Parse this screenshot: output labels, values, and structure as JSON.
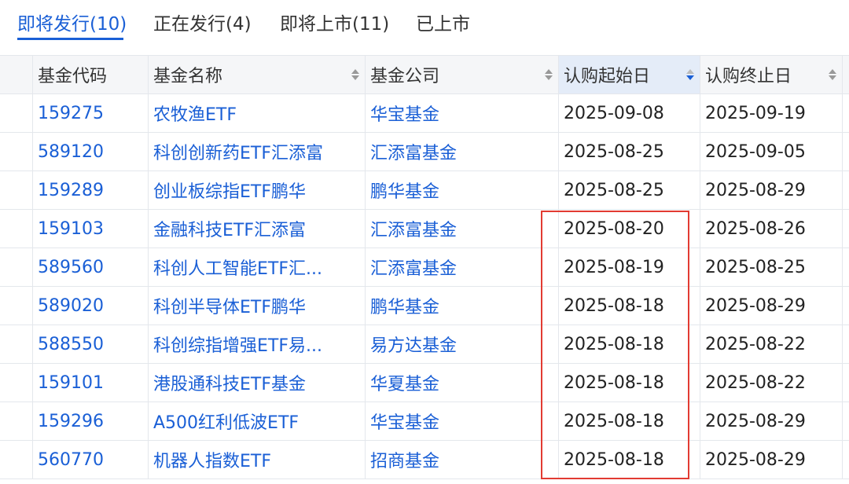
{
  "tabs": [
    {
      "label": "即将发行(10)",
      "active": true
    },
    {
      "label": "正在发行(4)",
      "active": false
    },
    {
      "label": "即将上市(11)",
      "active": false
    },
    {
      "label": "已上市",
      "active": false
    }
  ],
  "table": {
    "headers": {
      "code": "基金代码",
      "name": "基金名称",
      "company": "基金公司",
      "start": "认购起始日",
      "end": "认购终止日"
    },
    "rows": [
      {
        "code": "159275",
        "name": "农牧渔ETF",
        "company": "华宝基金",
        "start": "2025-09-08",
        "end": "2025-09-19"
      },
      {
        "code": "589120",
        "name": "科创创新药ETF汇添富",
        "company": "汇添富基金",
        "start": "2025-08-25",
        "end": "2025-09-05"
      },
      {
        "code": "159289",
        "name": "创业板综指ETF鹏华",
        "company": "鹏华基金",
        "start": "2025-08-25",
        "end": "2025-08-29"
      },
      {
        "code": "159103",
        "name": "金融科技ETF汇添富",
        "company": "汇添富基金",
        "start": "2025-08-20",
        "end": "2025-08-26"
      },
      {
        "code": "589560",
        "name": "科创人工智能ETF汇...",
        "company": "汇添富基金",
        "start": "2025-08-19",
        "end": "2025-08-25"
      },
      {
        "code": "589020",
        "name": "科创半导体ETF鹏华",
        "company": "鹏华基金",
        "start": "2025-08-18",
        "end": "2025-08-29"
      },
      {
        "code": "588550",
        "name": "科创综指增强ETF易...",
        "company": "易方达基金",
        "start": "2025-08-18",
        "end": "2025-08-22"
      },
      {
        "code": "159101",
        "name": "港股通科技ETF基金",
        "company": "华夏基金",
        "start": "2025-08-18",
        "end": "2025-08-22"
      },
      {
        "code": "159296",
        "name": "A500红利低波ETF",
        "company": "华宝基金",
        "start": "2025-08-18",
        "end": "2025-08-29"
      },
      {
        "code": "560770",
        "name": "机器人指数ETF",
        "company": "招商基金",
        "start": "2025-08-18",
        "end": "2025-08-29"
      }
    ]
  },
  "colors": {
    "accent": "#1a5fd6",
    "highlight": "#e23b32",
    "sorted_bg": "#e4ecf8"
  }
}
